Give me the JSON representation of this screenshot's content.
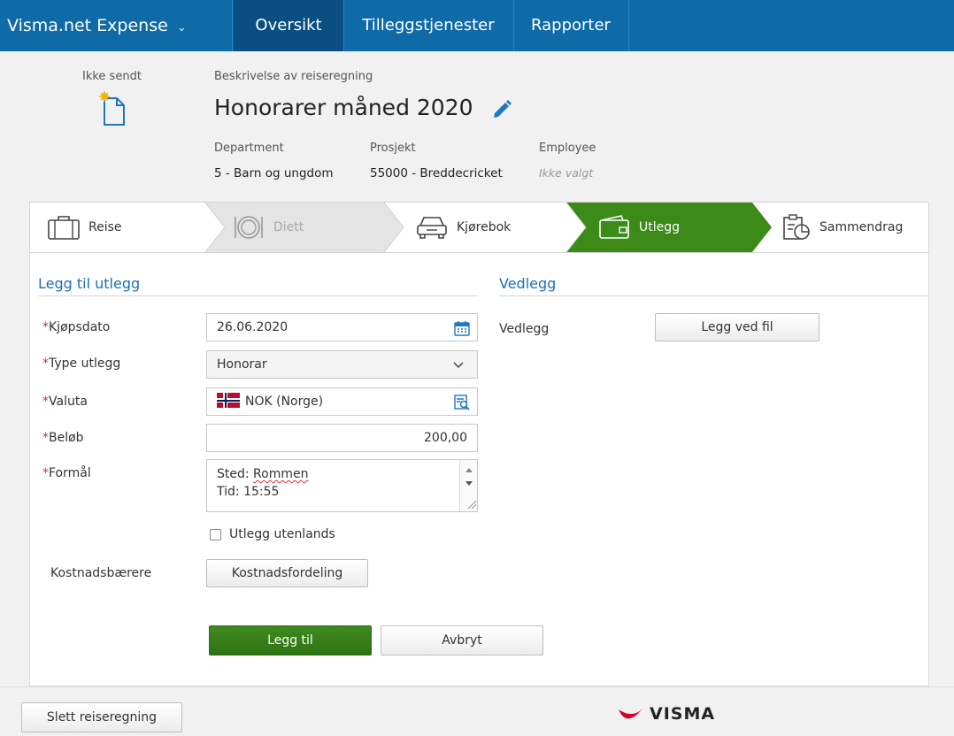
{
  "app": {
    "name": "Visma.net Expense"
  },
  "nav": {
    "tabs": [
      {
        "label": "Oversikt"
      },
      {
        "label": "Tilleggstjenester"
      },
      {
        "label": "Rapporter"
      }
    ]
  },
  "header": {
    "status": "Ikke sendt",
    "description_label": "Beskrivelse av reiseregning",
    "title": "Honorarer måned 2020",
    "meta": [
      {
        "label": "Department",
        "value": "5 - Barn og ungdom"
      },
      {
        "label": "Prosjekt",
        "value": "55000 - Breddecricket"
      },
      {
        "label": "Employee",
        "value": "Ikke valgt"
      }
    ]
  },
  "steps": [
    {
      "label": "Reise",
      "icon": "suitcase-icon",
      "state": "normal"
    },
    {
      "label": "Diett",
      "icon": "plate-icon",
      "state": "disabled"
    },
    {
      "label": "Kjørebok",
      "icon": "car-icon",
      "state": "normal"
    },
    {
      "label": "Utlegg",
      "icon": "wallet-icon",
      "state": "active"
    },
    {
      "label": "Sammendrag",
      "icon": "summary-icon",
      "state": "normal"
    }
  ],
  "form": {
    "section_title": "Legg til utlegg",
    "purchase_date": {
      "label": "Kjøpsdato",
      "value": "26.06.2020"
    },
    "expense_type": {
      "label": "Type utlegg",
      "value": "Honorar"
    },
    "currency": {
      "label": "Valuta",
      "value": "NOK (Norge)"
    },
    "amount": {
      "label": "Beløb",
      "value": "200,00"
    },
    "purpose": {
      "label": "Formål",
      "line1_prefix": "Sted: ",
      "line1_word": "Rommen",
      "line2": "Tid: 15:55"
    },
    "abroad_checkbox": {
      "label": "Utlegg utenlands",
      "checked": false
    },
    "cost_carriers": {
      "label": "Kostnadsbærere",
      "button": "Kostnadsfordeling"
    },
    "add_button": "Legg til",
    "cancel_button": "Avbryt"
  },
  "attachments": {
    "section_title": "Vedlegg",
    "label": "Vedlegg",
    "button": "Legg ved fil"
  },
  "footer": {
    "delete_button": "Slett reiseregning",
    "logo_text": "VISMA"
  },
  "colors": {
    "nav_bg": "#0f6aa8",
    "nav_active": "#0a4e82",
    "active_step": "#3c8a18",
    "link_blue": "#1f6fb2",
    "required": "#c8342f"
  }
}
